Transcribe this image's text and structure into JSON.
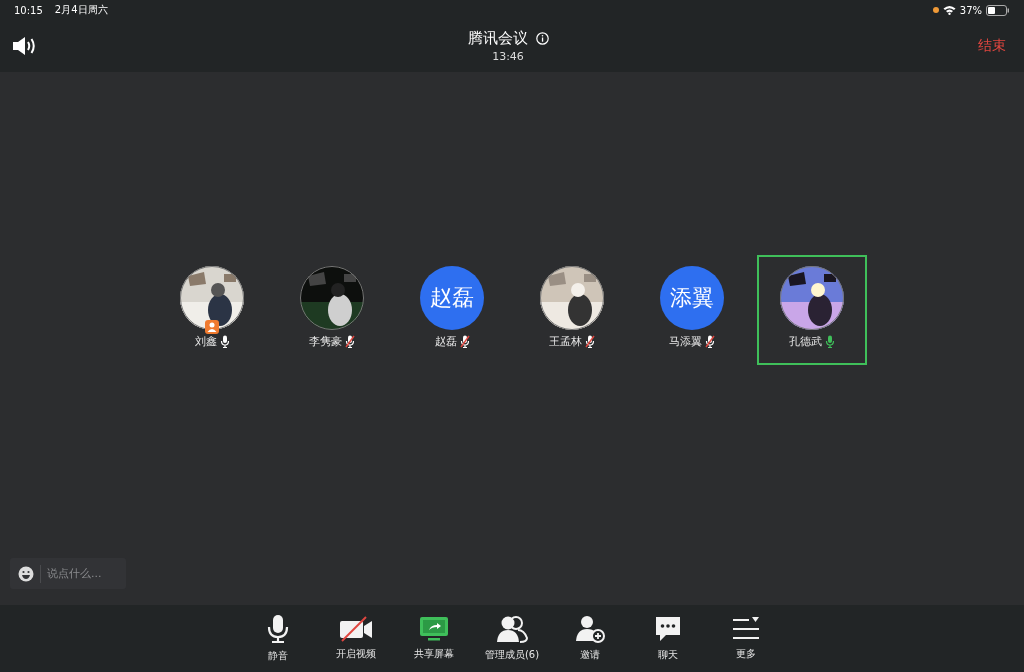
{
  "status_bar": {
    "time": "10:15",
    "date": "2月4日周六",
    "battery": "37%",
    "recording_dot": true
  },
  "header": {
    "title": "腾讯会议",
    "duration": "13:46",
    "end_button": "结束"
  },
  "participants": [
    {
      "name": "刘鑫",
      "kind": "picture",
      "muted": false,
      "speaking": false,
      "host": true,
      "selected": false
    },
    {
      "name": "李隽豪",
      "kind": "picture",
      "muted": true,
      "speaking": false,
      "host": false,
      "selected": false
    },
    {
      "name": "赵磊",
      "kind": "initials",
      "initials": "赵磊",
      "muted": true,
      "speaking": false,
      "host": false,
      "selected": false
    },
    {
      "name": "王孟林",
      "kind": "picture",
      "muted": true,
      "speaking": false,
      "host": false,
      "selected": false
    },
    {
      "name": "马添翼",
      "kind": "initials",
      "initials": "添翼",
      "muted": true,
      "speaking": false,
      "host": false,
      "selected": false
    },
    {
      "name": "孔德武",
      "kind": "picture",
      "muted": false,
      "speaking": true,
      "host": false,
      "selected": true
    }
  ],
  "chat_input": {
    "placeholder": "说点什么..."
  },
  "toolbar": [
    {
      "kind": "mic",
      "label": "静音"
    },
    {
      "kind": "video_off",
      "label": "开启视频"
    },
    {
      "kind": "share",
      "label": "共享屏幕"
    },
    {
      "kind": "members",
      "label": "管理成员(6)"
    },
    {
      "kind": "invite",
      "label": "邀请"
    },
    {
      "kind": "chat",
      "label": "聊天"
    },
    {
      "kind": "more",
      "label": "更多"
    }
  ]
}
